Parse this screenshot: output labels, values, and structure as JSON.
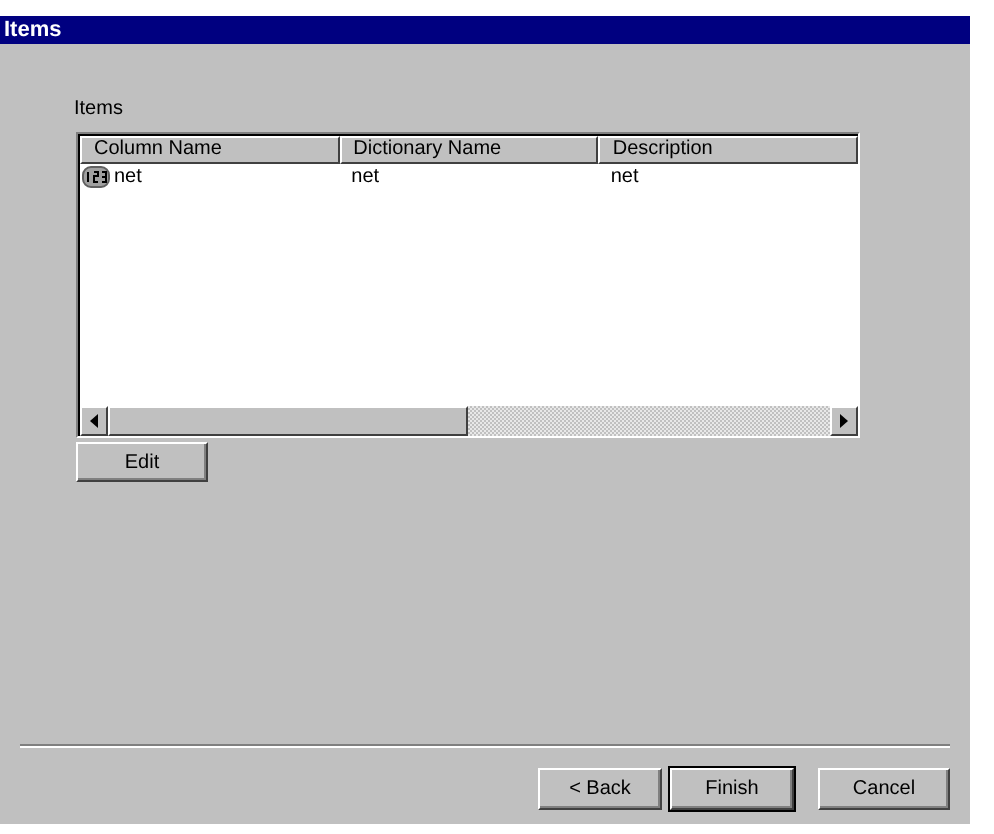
{
  "window": {
    "title": "Items"
  },
  "list_label": "Items",
  "table": {
    "columns": [
      "Column Name",
      "Dictionary Name",
      "Description"
    ],
    "rows": [
      {
        "cells": [
          "net",
          "net",
          "net"
        ],
        "selected": false
      }
    ]
  },
  "edit_button": "Edit",
  "buttons": [
    {
      "label": "< Back",
      "default": false
    },
    {
      "label": "Finish",
      "default": true
    },
    {
      "label": "Cancel",
      "default": false
    }
  ]
}
